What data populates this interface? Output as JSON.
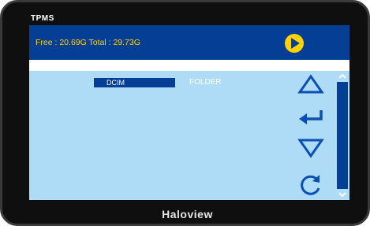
{
  "device": {
    "title": "TPMS",
    "brand": "Haloview"
  },
  "storage": {
    "text": "Free : 20.69G  Total : 29.73G"
  },
  "file_list": {
    "items": [
      {
        "name": "DCIM",
        "type": "FOLDER"
      }
    ]
  },
  "icons": {
    "play": "play-icon",
    "up": "triangle-up-icon",
    "enter": "enter-arrow-icon",
    "down": "triangle-down-icon",
    "refresh": "refresh-icon",
    "scroll_up": "chevron-up-icon",
    "scroll_down": "chevron-down-icon"
  },
  "colors": {
    "bar_blue": "#043e95",
    "screen_bg": "#aedbf5",
    "text_yellow": "#ffd200",
    "icon_blue": "#0b4fb4"
  }
}
